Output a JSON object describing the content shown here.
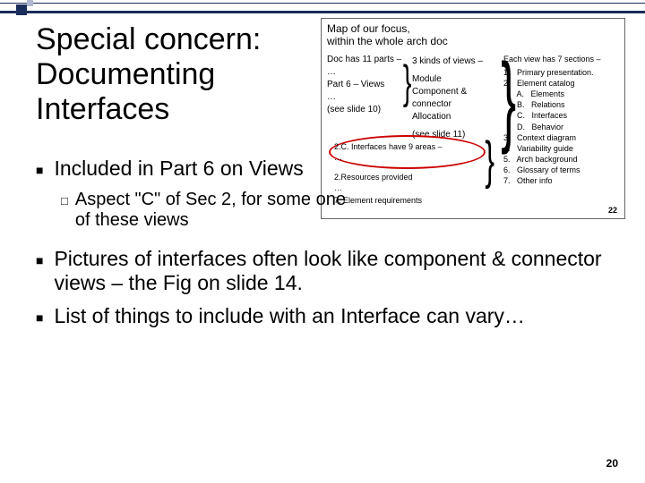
{
  "title": "Special concern: Documenting Interfaces",
  "bullets": {
    "b1": "Included in Part 6 on Views",
    "sub1": "Aspect \"C\" of Sec 2, for some one of these views",
    "b2": "Pictures of interfaces often look like component & connector views – the Fig on slide 14.",
    "b3": "List of things to include with an Interface can vary…"
  },
  "diagram": {
    "title": "Map of our focus,\nwithin the whole arch doc",
    "left": {
      "l1": "Doc has 11 parts –",
      "l2": "…",
      "l3": "Part 6 – Views",
      "l4": "…",
      "l5": "(see slide 10)"
    },
    "mid": {
      "m1": "3 kinds of views –",
      "m2": "Module",
      "m3": "Component & connector",
      "m4": "Allocation",
      "m5": "(see slide 11)"
    },
    "right_head": "Each view has 7 sections –",
    "right": {
      "r1": "1.   Primary presentation.",
      "r2": "2.   Element catalog",
      "r2a": "      A.   Elements",
      "r2b": "      B.   Relations",
      "r2c": "      C.   Interfaces",
      "r2d": "      D.   Behavior",
      "r3": "3.   Context diagram",
      "r4": "4.   Variability guide",
      "r5": "5.   Arch background",
      "r6": "6.   Glossary of terms",
      "r7": "7.   Other info"
    },
    "intf": "2.C. Interfaces have 9 areas –\n…",
    "res": "2.Resources provided\n…",
    "elem": "7. Element requirements",
    "pg": "22"
  },
  "page": "20"
}
